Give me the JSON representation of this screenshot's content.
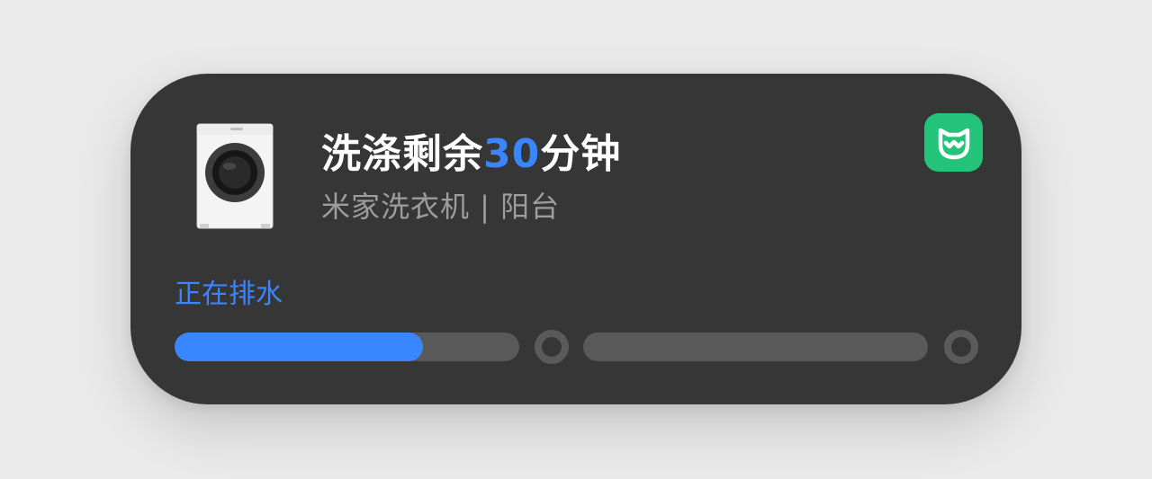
{
  "notification": {
    "title_prefix": "洗涤剩余",
    "title_number": "30",
    "title_suffix": "分钟",
    "subtitle": "米家洗衣机 | 阳台",
    "status": "正在排水",
    "app_icon": "mijia-icon",
    "device_image": "washing-machine-icon"
  },
  "progress": {
    "stages": [
      {
        "fill": 0.72
      },
      {
        "fill": 0.0
      }
    ]
  },
  "colors": {
    "card_background": "#363636",
    "accent_blue": "#3a86ff",
    "app_icon_green": "#23c47a",
    "track_gray": "#595959"
  }
}
